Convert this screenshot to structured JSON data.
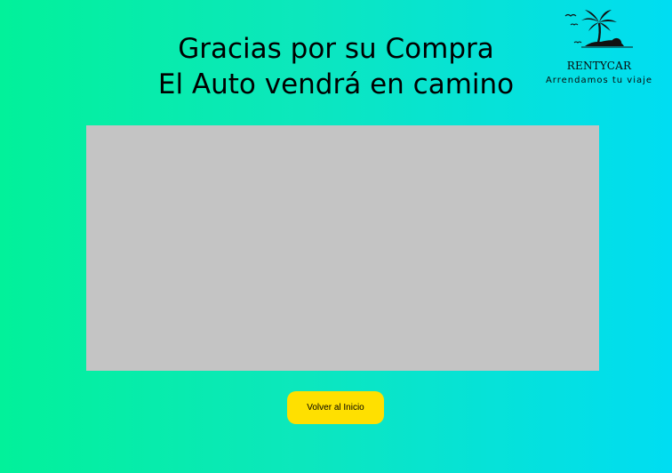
{
  "header": {
    "title_line1": "Gracias por su Compra",
    "title_line2": "El Auto vendrá en camino"
  },
  "logo": {
    "icon": "palm-island-logo-icon",
    "brand": "RENTYCAR",
    "tagline": "Arrendamos tu viaje"
  },
  "main": {
    "image_placeholder_color": "#C4C4C4"
  },
  "actions": {
    "home_label": "Volver al Inicio",
    "button_color": "#FFE000"
  },
  "colors": {
    "gradient_start": "#02F19A",
    "gradient_end": "#00DDF2"
  }
}
